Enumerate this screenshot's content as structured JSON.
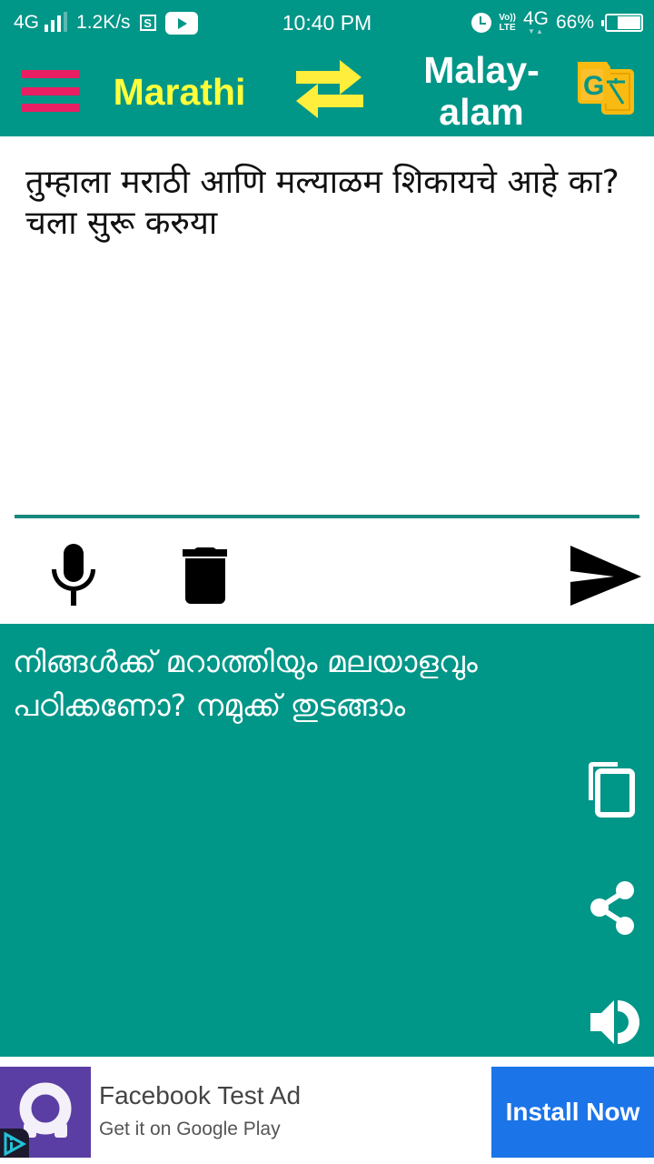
{
  "status_bar": {
    "network_left": "4G",
    "signal_strength": "3 of 4 bars",
    "data_speed": "1.2K/s",
    "notification_icons": [
      "s-icon",
      "youtube-icon"
    ],
    "time": "10:40 PM",
    "alarm_icon": "alarm-icon",
    "volte_top": "Vo))",
    "volte_bottom": "LTE",
    "network_right": "4G",
    "network_arrows": "▼▲",
    "battery_percent": "66%",
    "battery_level": 0.66
  },
  "toolbar": {
    "menu_icon": "hamburger-menu-icon",
    "source_language": "Marathi",
    "swap_icon": "swap-arrows-icon",
    "target_language_line1": "Malay-",
    "target_language_line2": "alam",
    "translate_icon": "google-translate-icon",
    "colors": {
      "background": "#009688",
      "menu": "#ea1e63",
      "source_language": "#ffff3b",
      "target_language": "#ffffff",
      "translate_icon": "#f9bb12"
    }
  },
  "input": {
    "text": "तुम्हाला मराठी आणि मल्याळम शिकायचे आहे का? चला सुरू करुया"
  },
  "actions": {
    "mic_icon": "microphone-icon",
    "delete_icon": "trash-icon",
    "send_icon": "send-icon"
  },
  "output": {
    "text": "നിങ്ങൾക്ക് മറാത്തിയും മലയാളവും പഠിക്കണോ? നമുക്ക് തുടങ്ങാം",
    "copy_icon": "copy-icon",
    "share_icon": "share-icon",
    "speak_icon": "speaker-icon"
  },
  "ad": {
    "title": "Facebook Test Ad",
    "subtitle": "Get it on Google Play",
    "cta_label": "Install Now",
    "icon": "app-logo-icon",
    "badge_icon": "ad-choices-icon",
    "colors": {
      "icon_background": "#5a3ea3",
      "cta_background": "#1b74e8"
    }
  }
}
